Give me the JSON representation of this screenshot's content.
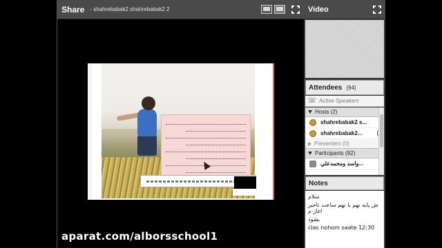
{
  "share": {
    "title": "Share",
    "presenter": "- shahrebabak2 shahrebabak2 2"
  },
  "video": {
    "title": "Video"
  },
  "attendees": {
    "title": "Attendees",
    "count": "(94)",
    "active_speakers": "Active Speakers",
    "hosts_label": "Hosts (2)",
    "hosts": [
      "shahrebabak2 s...",
      "shahrebabak2..."
    ],
    "presenters_label": "Presenters (0)",
    "participants_label": "Participants (92)",
    "participants": [
      "واسد ومحمدعلي..."
    ]
  },
  "notes": {
    "title": "Notes",
    "lines": [
      "سلام",
      "ش پایه نهم با نهم ساعت تاخیر اغاز م",
      "بشود"
    ],
    "line_latin": "clas nohom saate 12:30"
  },
  "watermark": "aparat.com/alborsschool1"
}
